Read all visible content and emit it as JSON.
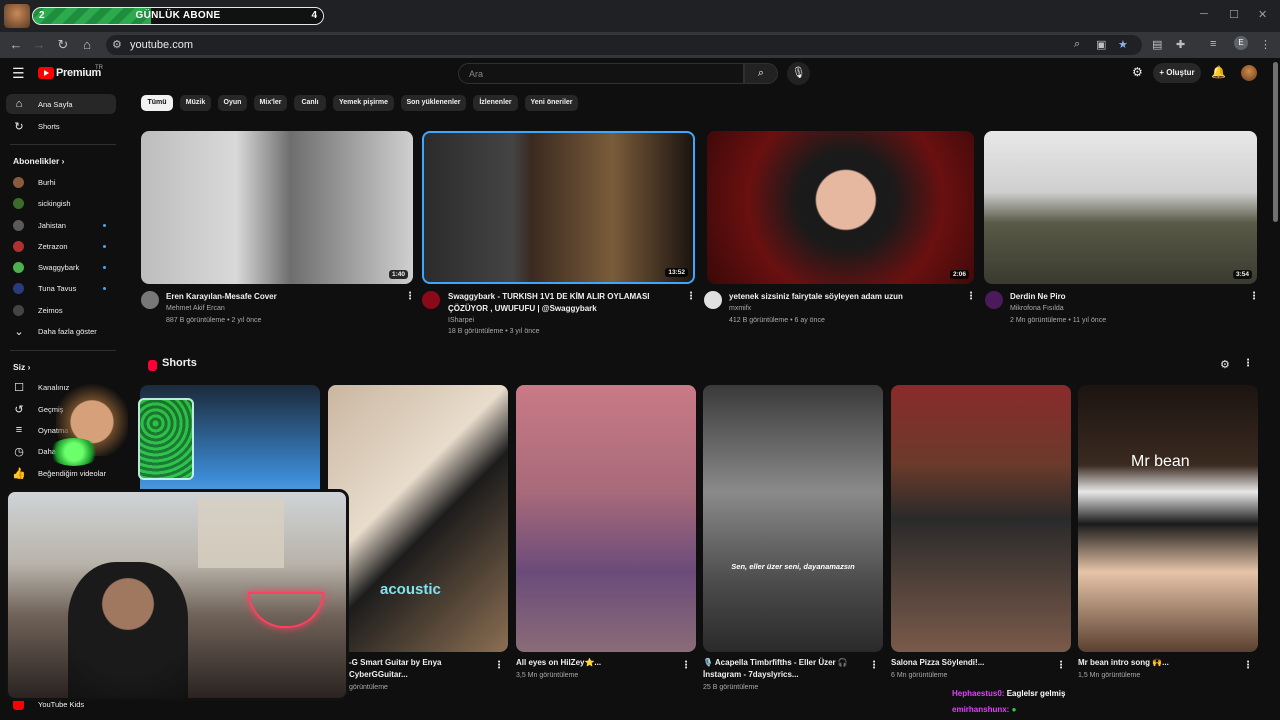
{
  "overlay": {
    "left_count": "2",
    "label": "GÜNLÜK ABONE",
    "right_count": "4"
  },
  "browser": {
    "url": "youtube.com",
    "profile_letter": "E"
  },
  "header": {
    "brand": "Premium",
    "region": "TR",
    "search_placeholder": "Ara",
    "create_label": "Oluştur"
  },
  "sidebar": {
    "main": [
      {
        "label": "Ana Sayfa",
        "icon": "home-icon"
      },
      {
        "label": "Shorts",
        "icon": "shorts-icon"
      }
    ],
    "subs_heading": "Abonelikler",
    "subscriptions": [
      {
        "label": "Burhi",
        "color": "#8a5a3c",
        "live": false
      },
      {
        "label": "sickingish",
        "color": "#3c6b2a",
        "live": false
      },
      {
        "label": "Jahistan",
        "color": "#5a5a5a",
        "live": true
      },
      {
        "label": "Zetrazon",
        "color": "#b03030",
        "live": true
      },
      {
        "label": "Swaggybark",
        "color": "#4caf50",
        "live": true
      },
      {
        "label": "Tuna Tavus",
        "color": "#2a3a7a",
        "live": true
      },
      {
        "label": "Zeimos",
        "color": "#444444",
        "live": false
      }
    ],
    "show_more": "Daha fazla göster",
    "you_heading": "Siz",
    "you": [
      {
        "label": "Kanalınız",
        "icon": "channel-icon"
      },
      {
        "label": "Geçmiş",
        "icon": "history-icon"
      },
      {
        "label": "Oynatma listeleri",
        "icon": "playlist-icon"
      },
      {
        "label": "Daha sonra izle",
        "icon": "clock-icon"
      },
      {
        "label": "Beğendiğim videolar",
        "icon": "like-icon"
      }
    ],
    "kids": "YouTube Kids"
  },
  "chips": [
    "Tümü",
    "Müzik",
    "Oyun",
    "Mix'ler",
    "Canlı",
    "Yemek pişirme",
    "Son yüklenenler",
    "İzlenenler",
    "Yeni öneriler"
  ],
  "videos": [
    {
      "title1": "Eren Karayılan-Mesafe Cover",
      "title2": "",
      "channel": "Mehmet Akif Ercan",
      "meta": "887 B görüntüleme • 2 yıl önce",
      "duration": "1:40"
    },
    {
      "title1": "Swaggybark -  TURKISH 1V1 DE KİM ALIR OYLAMASI",
      "title2": "ÇÖZÜYOR , UWUFUFU | @Swaggybark",
      "channel": "ISharpei",
      "meta": "18 B görüntüleme • 3 yıl önce",
      "duration": "13:52"
    },
    {
      "title1": "yetenek sizsiniz fairytale söyleyen adam uzun",
      "title2": "",
      "channel": "mxmifx",
      "meta": "412 B görüntüleme • 6 ay önce",
      "duration": "2:06"
    },
    {
      "title1": "Derdin Ne Piro",
      "title2": "",
      "channel": "Mikrofona Fısılda",
      "meta": "2 Mn görüntüleme • 11 yıl önce",
      "duration": "3:54"
    }
  ],
  "shorts_heading": "Shorts",
  "shorts": [
    {
      "title": "",
      "views": ""
    },
    {
      "title": "-G Smart Guitar by Enya",
      "title2": "CyberGGuitar...",
      "views": "görüntüleme",
      "overlay": "acoustic"
    },
    {
      "title": "All eyes on HilZey⭐...",
      "views": "3,5 Mn görüntüleme"
    },
    {
      "title": "🎙️ Acapella Timbrfifths - Eller Üzer 🎧",
      "title2": "İnstagram - 7dayslyrics...",
      "views": "25 B görüntüleme",
      "caption": "Sen, eller üzer seni, dayanamazsın"
    },
    {
      "title": "Salona Pizza Söylendi!...",
      "views": "6 Mn görüntüleme"
    },
    {
      "title": "Mr bean intro song 🙌...",
      "views": "1,5 Mn görüntüleme",
      "overlay": "Mr bean"
    }
  ],
  "chat": [
    {
      "user": "Hephaestus0:",
      "message": "Eaglelsr gelmiş",
      "user_color": "#e040fb"
    },
    {
      "user": "emirhanshunx:",
      "message": "",
      "user_color": "#e040fb"
    }
  ]
}
